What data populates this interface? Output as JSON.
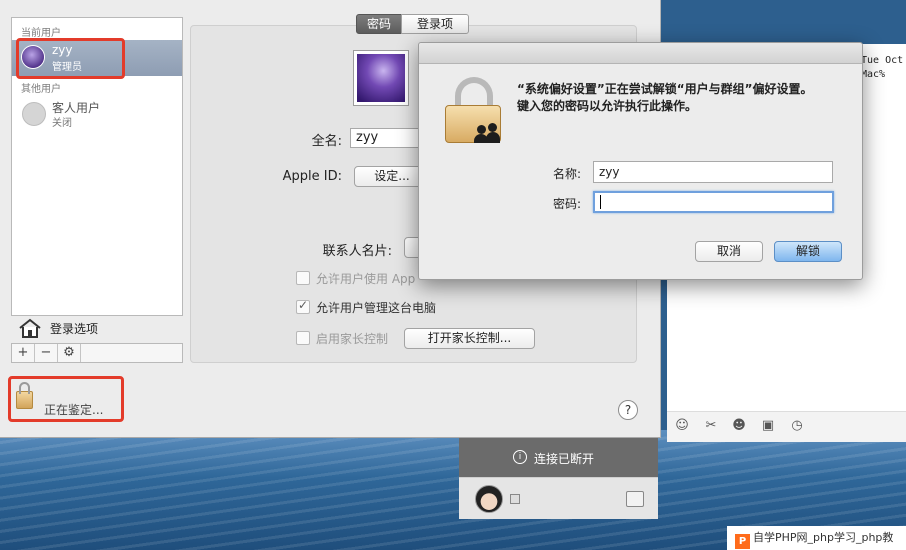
{
  "colors": {
    "selection": "#8e9db3",
    "highlight_annotation": "#e33b2a",
    "default_button": "#7fb6ee",
    "connection_bar": "#6b6b6b"
  },
  "sidebar": {
    "current_user_label": "当前用户",
    "current_user": {
      "name": "zyy",
      "role": "管理员"
    },
    "other_users_label": "其他用户",
    "other_users": [
      {
        "name": "客人用户",
        "status": "关闭"
      }
    ],
    "login_options_label": "登录选项",
    "toolbar": {
      "add": "+",
      "remove": "−",
      "settings_icon": "gear-icon"
    }
  },
  "tabs": [
    {
      "label": "密码",
      "active": true
    },
    {
      "label": "登录项",
      "active": false
    }
  ],
  "form": {
    "full_name_label": "全名:",
    "full_name_value": "zyy",
    "apple_id_label": "Apple ID:",
    "apple_id_button": "设定...",
    "contact_card_label": "联系人名片:",
    "checkbox_apple_id": {
      "label": "允许用户使用 App",
      "checked": false,
      "enabled": false
    },
    "checkbox_admin": {
      "label": "允许用户管理这台电脑",
      "checked": true,
      "enabled": true
    },
    "checkbox_parental": {
      "label": "启用家长控制",
      "checked": false,
      "enabled": false
    },
    "parental_button": "打开家长控制..."
  },
  "lock": {
    "status": "正在鉴定..."
  },
  "help": {
    "label": "?"
  },
  "dialog": {
    "line1": "“系统偏好设置”正在尝试解锁“用户与群组”偏好设置。",
    "line2": "键入您的密码以允许执行此操作。",
    "name_label": "名称:",
    "name_value": "zyy",
    "password_label": "密码:",
    "password_value": "",
    "cancel": "取消",
    "unlock": "解锁"
  },
  "terminal": {
    "lines": [
      "Tue Oct",
      "Mac%"
    ]
  },
  "chat": {
    "connection_status": "连接已断开",
    "toolbar_icons": [
      "smiley-icon",
      "scissors-icon",
      "emoji-icon",
      "image-icon",
      "clock-icon"
    ]
  },
  "watermark": {
    "logo": "P",
    "text": "自学PHP网_php学习_php教"
  }
}
